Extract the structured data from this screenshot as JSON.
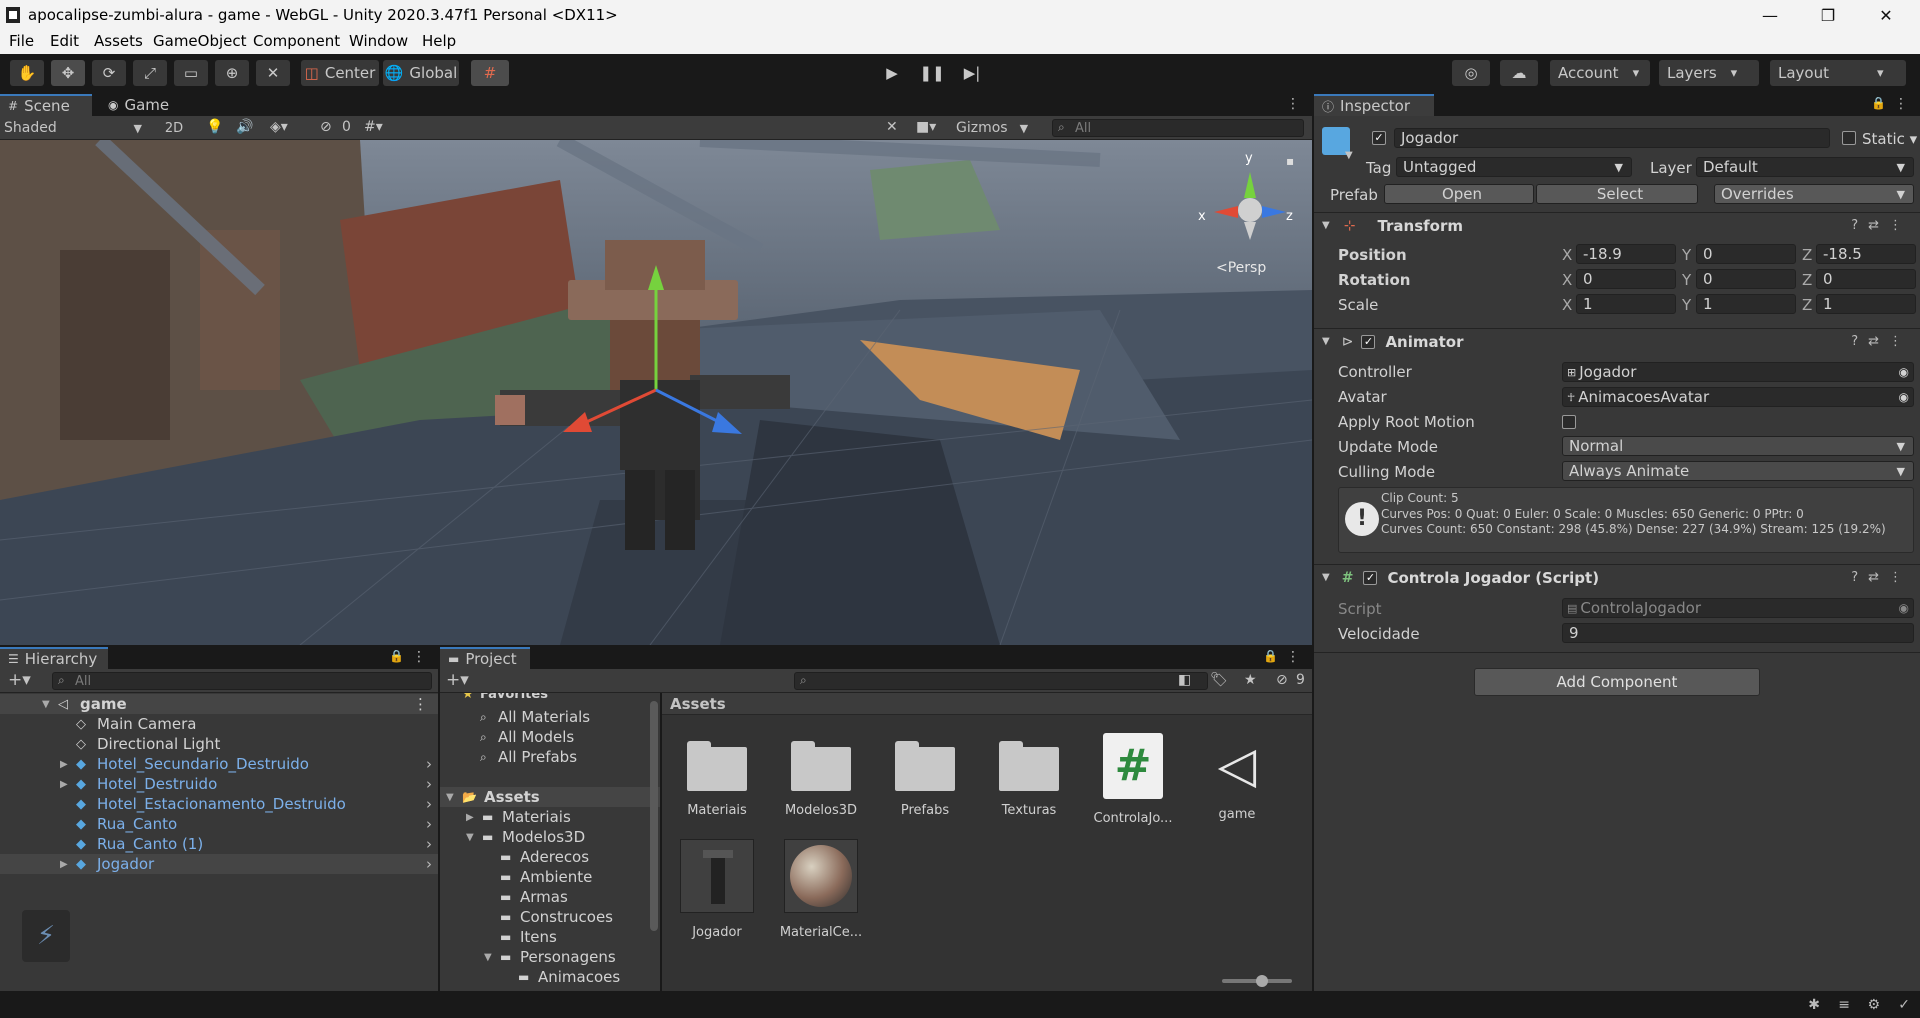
{
  "window": {
    "title": "apocalipse-zumbi-alura - game - WebGL - Unity 2020.3.47f1 Personal <DX11>",
    "controls": [
      "—",
      "❐",
      "✕"
    ]
  },
  "menu": [
    "File",
    "Edit",
    "Assets",
    "GameObject",
    "Component",
    "Window",
    "Help"
  ],
  "toolbar": {
    "tools": [
      "hand-tool",
      "move-tool",
      "rotate-tool",
      "scale-tool",
      "rect-tool",
      "transform-tool",
      "custom-tool"
    ],
    "pivot": "Center",
    "space": "Global",
    "account": "Account",
    "layers": "Layers",
    "layout": "Layout"
  },
  "scene": {
    "tabs": [
      "Scene",
      "Game"
    ],
    "shading": "Shaded",
    "mode2d": "2D",
    "hidden_count": "0",
    "gizmos": "Gizmos",
    "search_placeholder": "All",
    "persp": "<Persp",
    "axis": {
      "y": "y",
      "x": "x",
      "z": "z"
    }
  },
  "hierarchy": {
    "title": "Hierarchy",
    "search_placeholder": "All",
    "scene": "game",
    "items": [
      {
        "label": "Main Camera",
        "prefab": false,
        "expandable": false
      },
      {
        "label": "Directional Light",
        "prefab": false,
        "expandable": false
      },
      {
        "label": "Hotel_Secundario_Destruido",
        "prefab": true,
        "expandable": true
      },
      {
        "label": "Hotel_Destruido",
        "prefab": true,
        "expandable": true
      },
      {
        "label": "Hotel_Estacionamento_Destruido",
        "prefab": true,
        "expandable": false
      },
      {
        "label": "Rua_Canto",
        "prefab": true,
        "expandable": false
      },
      {
        "label": "Rua_Canto (1)",
        "prefab": true,
        "expandable": false
      },
      {
        "label": "Jogador",
        "prefab": true,
        "expandable": true
      }
    ]
  },
  "project": {
    "title": "Project",
    "hidden_count": "9",
    "favorites": "Favorites",
    "fav_items": [
      "All Materials",
      "All Models",
      "All Prefabs"
    ],
    "tree_root": "Assets",
    "tree": [
      {
        "label": "Materiais",
        "depth": 1,
        "arrow": "▶"
      },
      {
        "label": "Modelos3D",
        "depth": 1,
        "arrow": "▼"
      },
      {
        "label": "Aderecos",
        "depth": 2,
        "arrow": ""
      },
      {
        "label": "Ambiente",
        "depth": 2,
        "arrow": ""
      },
      {
        "label": "Armas",
        "depth": 2,
        "arrow": ""
      },
      {
        "label": "Construcoes",
        "depth": 2,
        "arrow": ""
      },
      {
        "label": "Itens",
        "depth": 2,
        "arrow": ""
      },
      {
        "label": "Personagens",
        "depth": 2,
        "arrow": "▼"
      },
      {
        "label": "Animacoes",
        "depth": 3,
        "arrow": ""
      }
    ],
    "breadcrumb": "Assets",
    "assets": [
      {
        "label": "Materiais",
        "kind": "folder"
      },
      {
        "label": "Modelos3D",
        "kind": "folder"
      },
      {
        "label": "Prefabs",
        "kind": "folder"
      },
      {
        "label": "Texturas",
        "kind": "folder"
      },
      {
        "label": "ControlaJo...",
        "kind": "script"
      },
      {
        "label": "game",
        "kind": "unity"
      },
      {
        "label": "Jogador",
        "kind": "prefab"
      },
      {
        "label": "MaterialCe...",
        "kind": "material"
      }
    ]
  },
  "inspector": {
    "title": "Inspector",
    "object_name": "Jogador",
    "static": "Static",
    "tag_label": "Tag",
    "tag": "Untagged",
    "layer_label": "Layer",
    "layer": "Default",
    "prefab_label": "Prefab",
    "open": "Open",
    "select": "Select",
    "overrides": "Overrides",
    "transform": {
      "title": "Transform",
      "rows": [
        {
          "label": "Position",
          "x": "-18.9",
          "y": "0",
          "z": "-18.5"
        },
        {
          "label": "Rotation",
          "x": "0",
          "y": "0",
          "z": "0"
        },
        {
          "label": "Scale",
          "x": "1",
          "y": "1",
          "z": "1"
        }
      ],
      "axis": {
        "x": "X",
        "y": "Y",
        "z": "Z"
      }
    },
    "animator": {
      "title": "Animator",
      "controller_label": "Controller",
      "controller": "Jogador",
      "avatar_label": "Avatar",
      "avatar": "AnimacoesAvatar",
      "root_motion_label": "Apply Root Motion",
      "update_label": "Update Mode",
      "update": "Normal",
      "culling_label": "Culling Mode",
      "culling": "Always Animate",
      "info": [
        "Clip Count: 5",
        "Curves Pos: 0 Quat: 0 Euler: 0 Scale: 0 Muscles: 650 Generic: 0 PPtr: 0",
        "Curves Count: 650 Constant: 298 (45.8%) Dense: 227 (34.9%) Stream: 125 (19.2%)"
      ]
    },
    "script": {
      "title": "Controla Jogador (Script)",
      "script_label": "Script",
      "script": "ControlaJogador",
      "speed_label": "Velocidade",
      "speed": "9"
    },
    "add_component": "Add Component"
  },
  "colors": {
    "accent": "#3a79bb",
    "prefab_text": "#7cb0ea",
    "panel": "#383838",
    "background": "#191919"
  }
}
